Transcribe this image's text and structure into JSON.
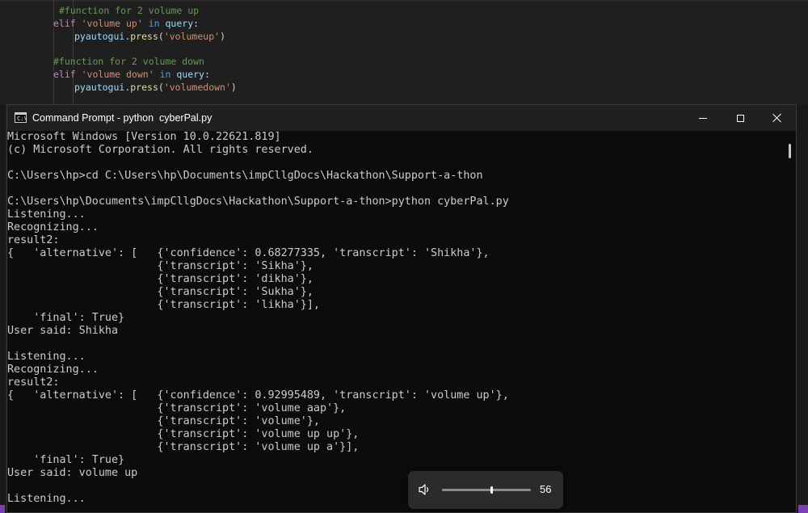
{
  "editor": {
    "lines": [
      {
        "segments": [
          {
            "t": "#function for 2 volume up",
            "c": "c-comment"
          }
        ]
      },
      {
        "segments": [
          {
            "t": "elif ",
            "c": "c-kw"
          },
          {
            "t": "'volume up'",
            "c": "c-str"
          },
          {
            "t": " in ",
            "c": "c-in"
          },
          {
            "t": "query",
            "c": "c-var"
          },
          {
            "t": ":",
            "c": "c-plain"
          }
        ]
      },
      {
        "segments": [
          {
            "t": "pyautogui",
            "c": "c-var"
          },
          {
            "t": ".",
            "c": "c-plain"
          },
          {
            "t": "press",
            "c": "c-fn"
          },
          {
            "t": "(",
            "c": "c-plain"
          },
          {
            "t": "'volumeup'",
            "c": "c-str"
          },
          {
            "t": ")",
            "c": "c-plain"
          }
        ]
      },
      {
        "segments": [
          {
            "t": "#function for 2 volume down",
            "c": "c-comment"
          }
        ]
      },
      {
        "segments": [
          {
            "t": "elif ",
            "c": "c-kw"
          },
          {
            "t": "'volume down'",
            "c": "c-str"
          },
          {
            "t": " in ",
            "c": "c-in"
          },
          {
            "t": "query",
            "c": "c-var"
          },
          {
            "t": ":",
            "c": "c-plain"
          }
        ]
      },
      {
        "segments": [
          {
            "t": "pyautogui",
            "c": "c-var"
          },
          {
            "t": ".",
            "c": "c-plain"
          },
          {
            "t": "press",
            "c": "c-fn"
          },
          {
            "t": "(",
            "c": "c-plain"
          },
          {
            "t": "'volumedown'",
            "c": "c-str"
          },
          {
            "t": ")",
            "c": "c-plain"
          }
        ]
      }
    ]
  },
  "window": {
    "title": "Command Prompt - python  cyberPal.py",
    "icon": "cmd-icon",
    "title_icon_prompt": "C:\\",
    "buttons": {
      "minimize": "minimize-icon",
      "maximize": "maximize-icon",
      "close": "close-icon"
    }
  },
  "console": {
    "lines": [
      "Microsoft Windows [Version 10.0.22621.819]",
      "(c) Microsoft Corporation. All rights reserved.",
      "",
      "C:\\Users\\hp>cd C:\\Users\\hp\\Documents\\impCllgDocs\\Hackathon\\Support-a-thon",
      "",
      "C:\\Users\\hp\\Documents\\impCllgDocs\\Hackathon\\Support-a-thon>python cyberPal.py",
      "Listening...",
      "Recognizing...",
      "result2:",
      "{   'alternative': [   {'confidence': 0.68277335, 'transcript': 'Shikha'},",
      "                       {'transcript': 'Sikha'},",
      "                       {'transcript': 'dikha'},",
      "                       {'transcript': 'Sukha'},",
      "                       {'transcript': 'likha'}],",
      "    'final': True}",
      "User said: Shikha",
      "",
      "Listening...",
      "Recognizing...",
      "result2:",
      "{   'alternative': [   {'confidence': 0.92995489, 'transcript': 'volume up'},",
      "                       {'transcript': 'volume aap'},",
      "                       {'transcript': 'volume'},",
      "                       {'transcript': 'volume up up'},",
      "                       {'transcript': 'volume up a'}],",
      "    'final': True}",
      "User said: volume up",
      "",
      "Listening..."
    ]
  },
  "volume_flyout": {
    "icon": "speaker-icon",
    "level": 56,
    "level_label": "56"
  },
  "colors": {
    "console_bg": "#0c0c0c",
    "console_fg": "#cccccc",
    "titlebar_bg": "#202020",
    "flyout_bg": "#2b2b2b"
  }
}
